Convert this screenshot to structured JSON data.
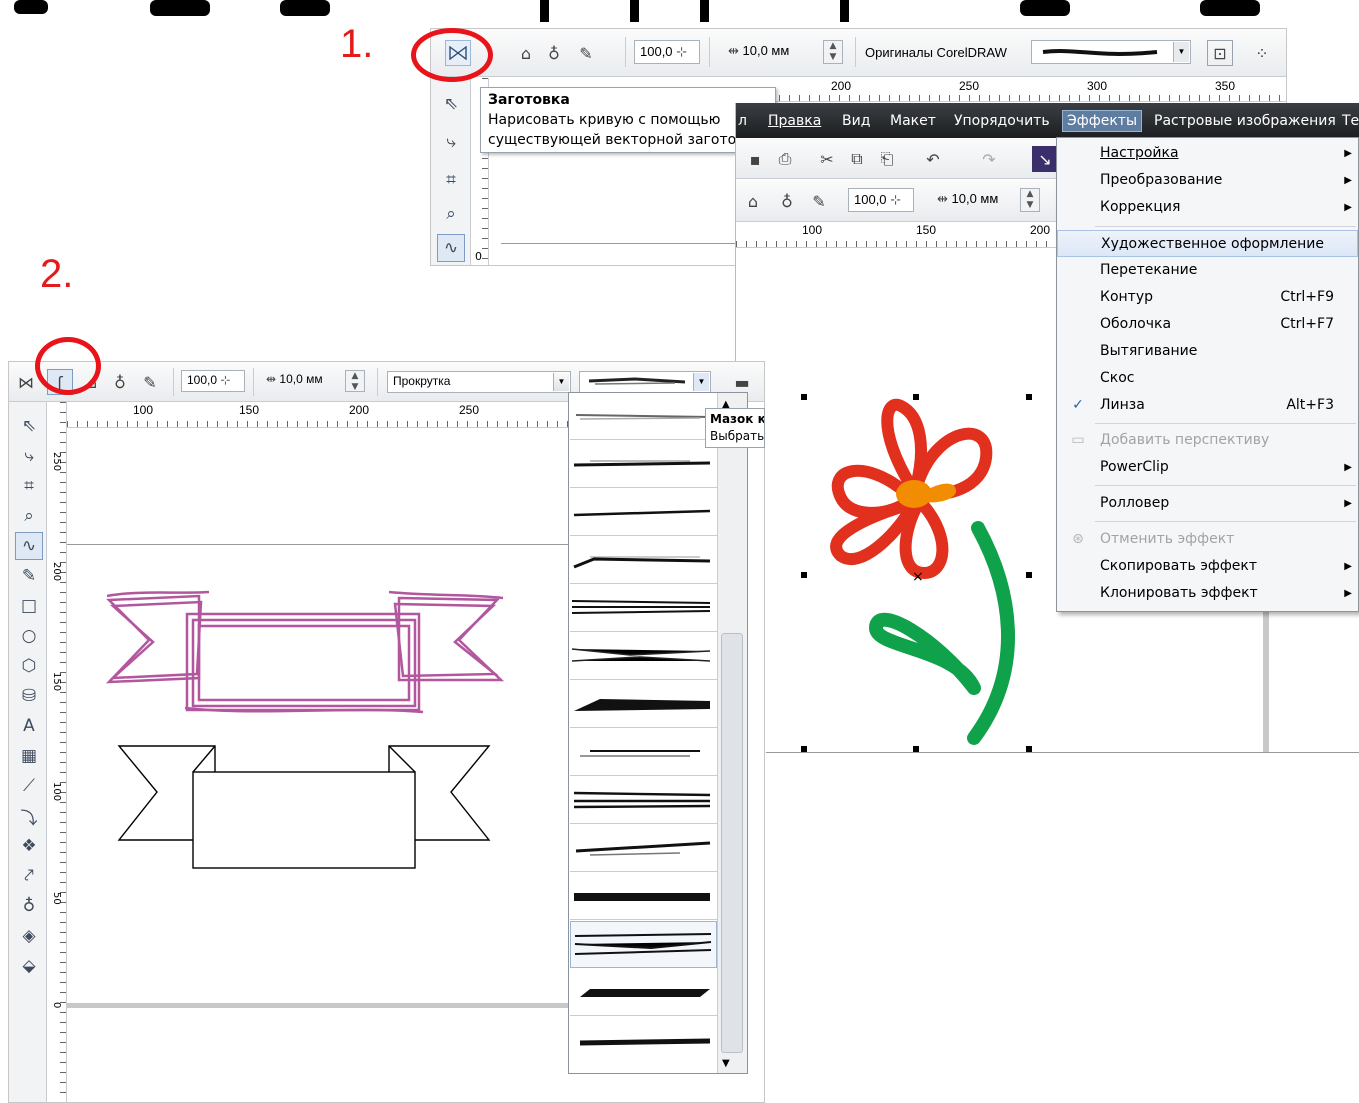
{
  "steps": {
    "one": "1.",
    "two": "2."
  },
  "panel1": {
    "toolbar": {
      "width_value": "100,0",
      "size_value": "10,0 мм",
      "preset_category": "Оригиналы CorelDRAW"
    },
    "ruler_numbers": [
      "200",
      "250",
      "300",
      "350"
    ],
    "vruler_number": "0",
    "tooltip": {
      "title": "Заготовка",
      "line1": "Нарисовать кривую с помощью",
      "line2": "существующей векторной загото"
    }
  },
  "panel3": {
    "menubar": [
      "л",
      "Правка",
      "Вид",
      "Макет",
      "Упорядочить",
      "Эффекты",
      "Растровые изображения",
      "Те"
    ],
    "toolbar": {
      "width_value": "100,0",
      "size_value": "10,0 мм"
    },
    "ruler_numbers": [
      "100",
      "150",
      "200"
    ],
    "menu": {
      "items": [
        {
          "label": "Настройка",
          "submenu": "▶"
        },
        {
          "label": "Преобразование",
          "submenu": "▶"
        },
        {
          "label": "Коррекция",
          "submenu": "▶"
        },
        {
          "label": "Художественное оформление"
        },
        {
          "label": "Перетекание"
        },
        {
          "label": "Контур",
          "shortcut": "Ctrl+F9"
        },
        {
          "label": "Оболочка",
          "shortcut": "Ctrl+F7"
        },
        {
          "label": "Вытягивание"
        },
        {
          "label": "Скос"
        },
        {
          "label": "Линза",
          "shortcut": "Alt+F3",
          "check": "✓"
        },
        {
          "label": "Добавить перспективу"
        },
        {
          "label": "PowerClip",
          "submenu": "▶"
        },
        {
          "label": "Ролловер",
          "submenu": "▶"
        },
        {
          "label": "Отменить эффект"
        },
        {
          "label": "Скопировать эффект",
          "submenu": "▶"
        },
        {
          "label": "Клонировать эффект",
          "submenu": "▶"
        }
      ]
    },
    "colors": {
      "petal": "#e2301f",
      "center": "#f28c00",
      "stem": "#10a14b"
    }
  },
  "panel2": {
    "toolbar": {
      "width_value": "100,0",
      "size_value": "10,0 мм",
      "category": "Прокрутка"
    },
    "ruler_numbers": [
      "100",
      "150",
      "200",
      "250"
    ],
    "vruler_numbers": [
      "250",
      "200",
      "150",
      "100",
      "50",
      "0"
    ],
    "tooltip": {
      "title": "Мазок к",
      "body": "Выбрать"
    },
    "colors": {
      "ribbon_sketch": "#b2579e"
    }
  }
}
